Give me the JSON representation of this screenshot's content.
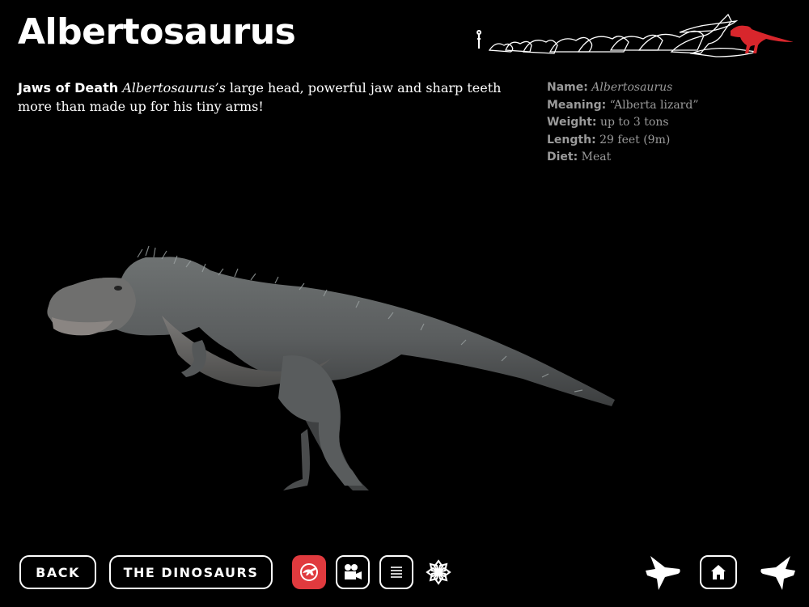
{
  "page": {
    "title": "Albertosaurus"
  },
  "caption": {
    "heading": "Jaws of Death",
    "species": "Albertosaurus’s",
    "text": " large head, powerful jaw and sharp teeth more than made up for his tiny arms!"
  },
  "facts": [
    {
      "key": "Name:",
      "value": " Albertosaurus"
    },
    {
      "key": "Meaning:",
      "value": " “Alberta lizard”"
    },
    {
      "key": "Weight:",
      "value": " up to 3 tons"
    },
    {
      "key": "Length:",
      "value": " 29 feet (9m)"
    },
    {
      "key": "Diet:",
      "value": " Meat"
    }
  ],
  "nav": {
    "back_label": "BACK",
    "dinosaurs_label": "THE DINOSAURS"
  },
  "icons": {
    "dino_view": "dinosaur-icon",
    "video": "video-camera-icon",
    "text": "text-lines-icon",
    "snowflake": "snowflake-icon",
    "prev": "prev-dinosaur-arrow-icon",
    "home": "home-icon",
    "next": "next-dinosaur-arrow-icon"
  },
  "colors": {
    "background": "#000000",
    "accent_red": "#e03a3e",
    "facts_text": "#9a9a9a",
    "highlight_silhouette": "#d8262c"
  }
}
